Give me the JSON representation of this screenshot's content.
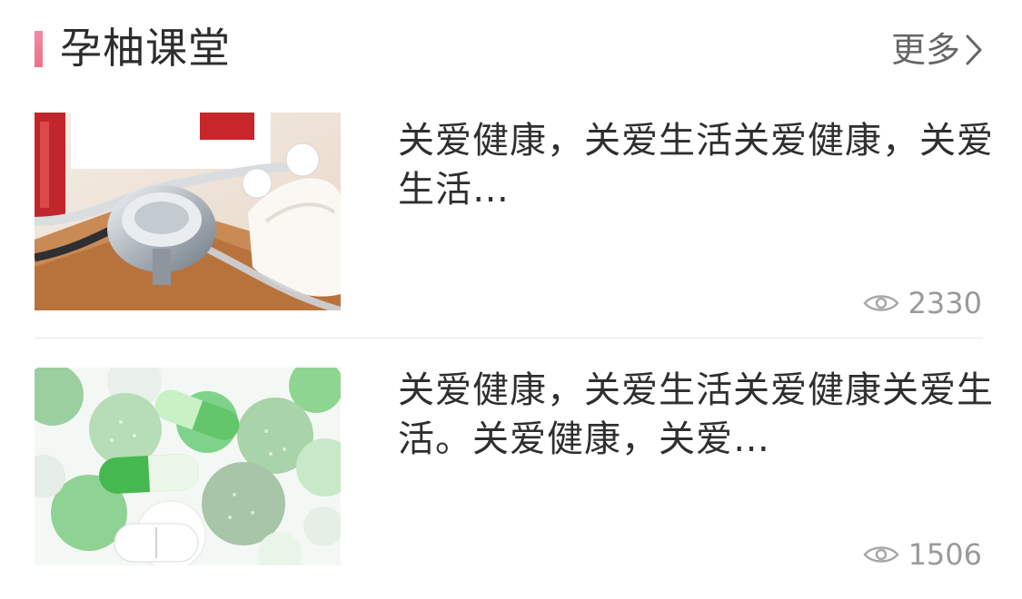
{
  "header": {
    "title": "孕柚课堂",
    "more_label": "更多",
    "accent_color": "#ee6f8a"
  },
  "articles": [
    {
      "title": "关爱健康，关爱生活关爱健康，关爱生活…",
      "views": "2330",
      "thumbnail": "stethoscope-and-medical-kit-photo"
    },
    {
      "title": "关爱健康，关爱生活关爱健康关爱生活。关爱健康，关爱…",
      "views": "1506",
      "thumbnail": "green-and-white-pills-photo"
    }
  ],
  "icons": {
    "view_count": "eye-icon",
    "more": "chevron-right-icon"
  }
}
